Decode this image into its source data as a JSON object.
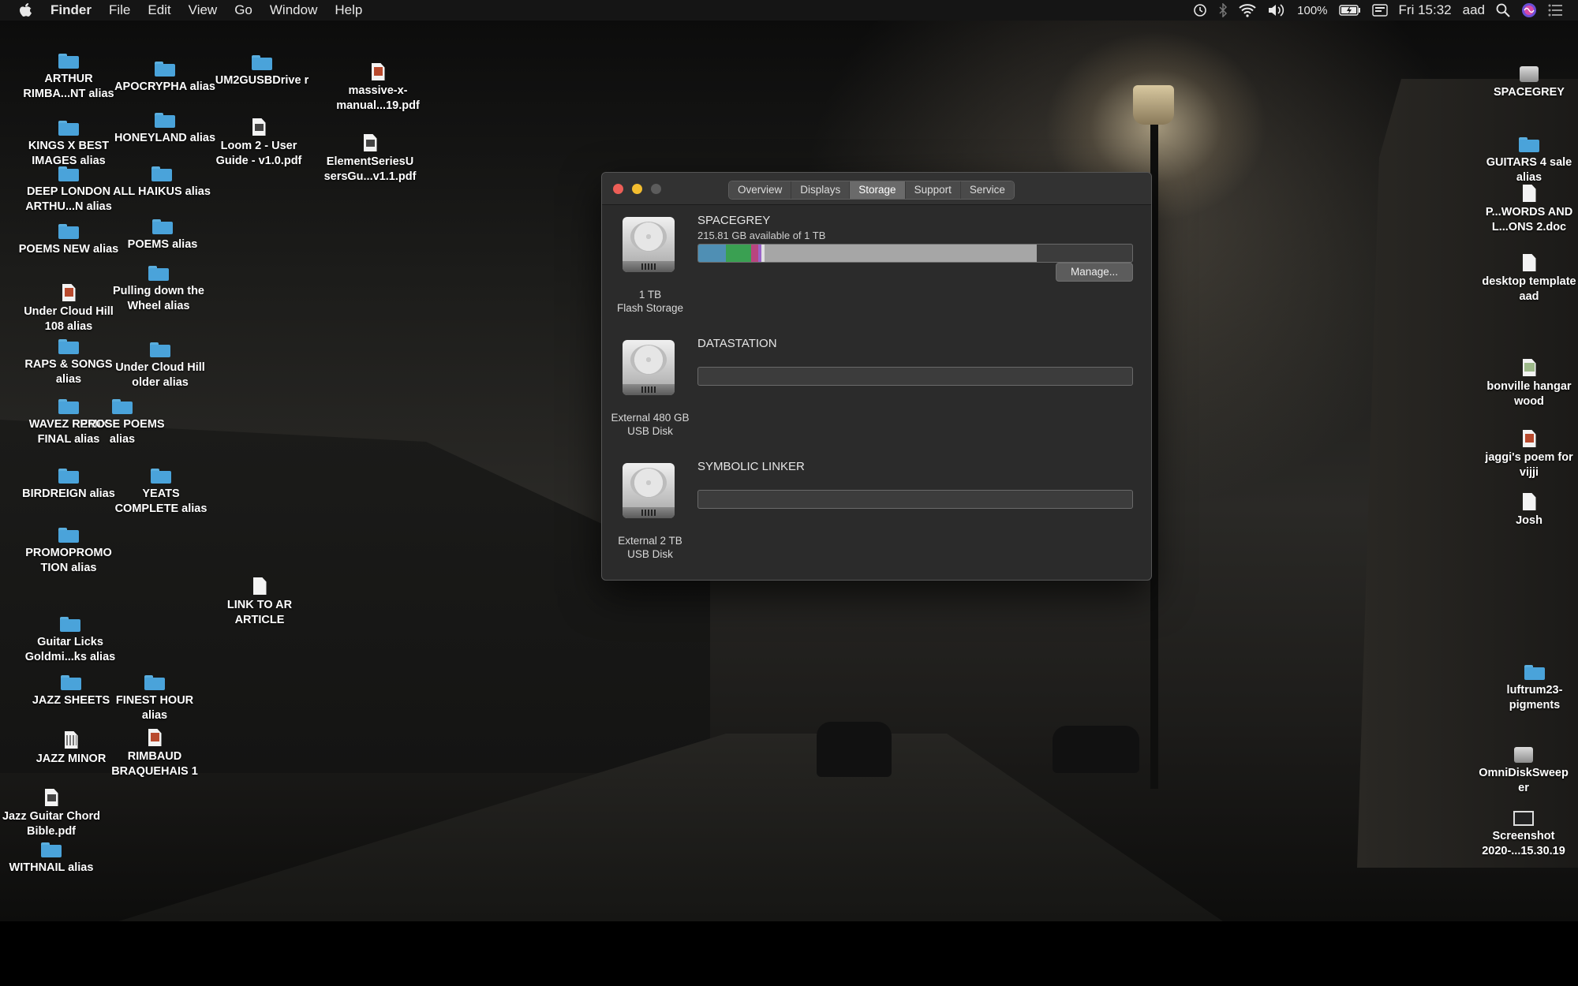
{
  "menubar": {
    "app": "Finder",
    "items": [
      "File",
      "Edit",
      "View",
      "Go",
      "Window",
      "Help"
    ],
    "battery": "100%",
    "clock": "Fri 15:32",
    "user": "aad"
  },
  "desktop_left": [
    {
      "label": "ARTHUR RIMBA...NT alias",
      "icon": "folder-icon"
    },
    {
      "label": "APOCRYPHA alias",
      "icon": "folder-icon"
    },
    {
      "label": "UM2GUSBDrive r",
      "icon": "folder-icon"
    },
    {
      "label": "massive-x-manual...19.pdf",
      "icon": "pdf-document-icon"
    },
    {
      "label": "KINGS X BEST IMAGES alias",
      "icon": "folder-icon"
    },
    {
      "label": "HONEYLAND alias",
      "icon": "folder-icon"
    },
    {
      "label": "Loom 2 - User Guide - v1.0.pdf",
      "icon": "pdf-document-icon"
    },
    {
      "label": "ElementSeriesU sersGu...v1.1.pdf",
      "icon": "pdf-document-icon"
    },
    {
      "label": "DEEP LONDON ARTHU...N alias",
      "icon": "folder-icon"
    },
    {
      "label": "ALL HAIKUS alias",
      "icon": "folder-icon"
    },
    {
      "label": "POEMS NEW alias",
      "icon": "folder-icon"
    },
    {
      "label": "POEMS alias",
      "icon": "folder-icon"
    },
    {
      "label": "Under Cloud Hill 108 alias",
      "icon": "document-icon"
    },
    {
      "label": "Pulling down the Wheel alias",
      "icon": "folder-icon"
    },
    {
      "label": "RAPS & SONGS alias",
      "icon": "folder-icon"
    },
    {
      "label": "Under Cloud Hill older alias",
      "icon": "folder-icon"
    },
    {
      "label": "WAVEZ REMIX FINAL alias",
      "icon": "folder-icon"
    },
    {
      "label": "PROSE POEMS alias",
      "icon": "folder-icon"
    },
    {
      "label": "BIRDREIGN alias",
      "icon": "folder-icon"
    },
    {
      "label": "YEATS COMPLETE alias",
      "icon": "folder-icon"
    },
    {
      "label": "PROMOPROMO TION alias",
      "icon": "folder-icon"
    },
    {
      "label": "LINK TO AR ARTICLE",
      "icon": "document-icon"
    },
    {
      "label": "Guitar Licks Goldmi...ks alias",
      "icon": "folder-icon"
    },
    {
      "label": "JAZZ SHEETS",
      "icon": "folder-icon"
    },
    {
      "label": "FINEST HOUR alias",
      "icon": "folder-icon"
    },
    {
      "label": "JAZZ MINOR",
      "icon": "sheet-icon"
    },
    {
      "label": "RIMBAUD BRAQUEHAIS 1",
      "icon": "image-icon"
    },
    {
      "label": "Jazz Guitar Chord Bible.pdf",
      "icon": "pdf-document-icon"
    },
    {
      "label": "WITHNAIL alias",
      "icon": "folder-icon"
    }
  ],
  "desktop_right": [
    {
      "label": "SPACEGREY",
      "icon": "drive-icon"
    },
    {
      "label": "GUITARS 4 sale alias",
      "icon": "folder-icon"
    },
    {
      "label": "P...WORDS AND L...ONS 2.doc",
      "icon": "document-icon"
    },
    {
      "label": "desktop template aad",
      "icon": "document-icon"
    },
    {
      "label": "bonville hangar wood",
      "icon": "map-icon"
    },
    {
      "label": "jaggi's poem for vijji",
      "icon": "image-icon"
    },
    {
      "label": "Josh",
      "icon": "document-icon"
    },
    {
      "label": "luftrum23-pigments",
      "icon": "folder-icon"
    },
    {
      "label": "OmniDiskSweep er",
      "icon": "drive-icon"
    },
    {
      "label": "Screenshot 2020-...15.30.19",
      "icon": "screenshot-icon"
    }
  ],
  "window": {
    "tabs": [
      "Overview",
      "Displays",
      "Storage",
      "Support",
      "Service"
    ],
    "active_tab": "Storage",
    "manage_label": "Manage...",
    "disks": [
      {
        "name": "SPACEGREY",
        "available": "215.81 GB available of 1 TB",
        "caption_line1": "1 TB",
        "caption_line2": "Flash Storage",
        "usage": [
          {
            "fraction": 0.063,
            "color": "#4f8fb4"
          },
          {
            "fraction": 0.058,
            "color": "#3aa052"
          },
          {
            "fraction": 0.018,
            "color": "#b8457f"
          },
          {
            "fraction": 0.006,
            "color": "#9a63c8"
          },
          {
            "fraction": 0.008,
            "color": "#e0e0e0"
          },
          {
            "fraction": 0.627,
            "color": "#a6a6a6"
          }
        ]
      },
      {
        "name": "DATASTATION",
        "available": "",
        "caption_line1": "External 480 GB",
        "caption_line2": "USB Disk",
        "usage": []
      },
      {
        "name": "SYMBOLIC LINKER",
        "available": "",
        "caption_line1": "External 2 TB",
        "caption_line2": "USB Disk",
        "usage": []
      }
    ]
  }
}
